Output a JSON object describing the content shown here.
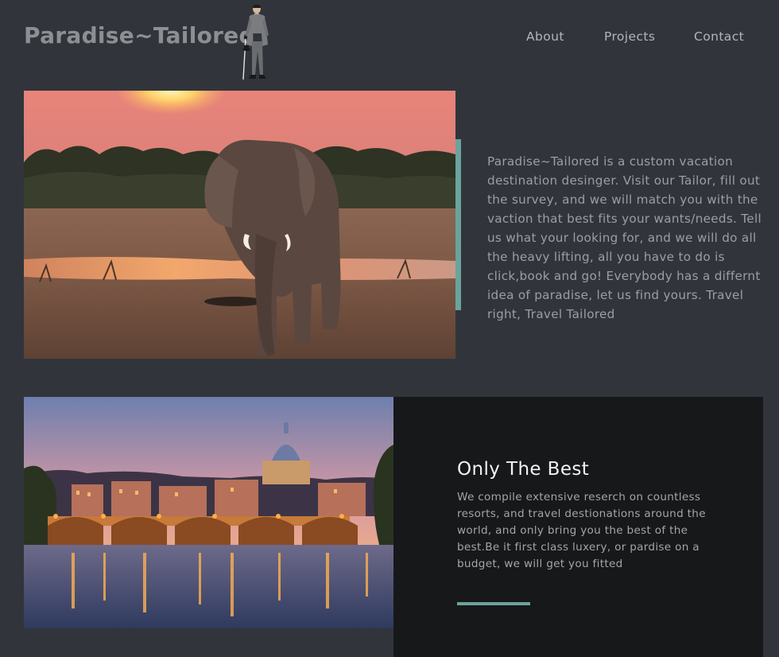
{
  "header": {
    "brand": "Paradise~Tailored",
    "mascot_icon": "gentleman-with-cane-icon",
    "nav": [
      {
        "label": "About"
      },
      {
        "label": "Projects"
      },
      {
        "label": "Contact"
      }
    ]
  },
  "hero": {
    "image_icon": "elephant-sunset-photo",
    "text": "Paradise~Tailored is a custom vacation destination desinger. Visit our Tailor, fill out the survey, and we will match you with the vaction that best fits your wants/needs. Tell us what your looking for, and we will do all the heavy lifting, all you have to do is click,book and go! Everybody has a differnt idea of paradise, let us find yours. Travel right, Travel Tailored"
  },
  "feature": {
    "image_icon": "rome-river-night-photo",
    "title": "Only The Best",
    "text": "We compile extensive reserch on countless resorts, and travel destionations around the world, and only bring you the best of the best.Be it first class luxery, or pardise on a budget, we will get you fitted"
  },
  "colors": {
    "background": "#31353b",
    "accent": "#6ba39d",
    "panel": "#17181a"
  }
}
